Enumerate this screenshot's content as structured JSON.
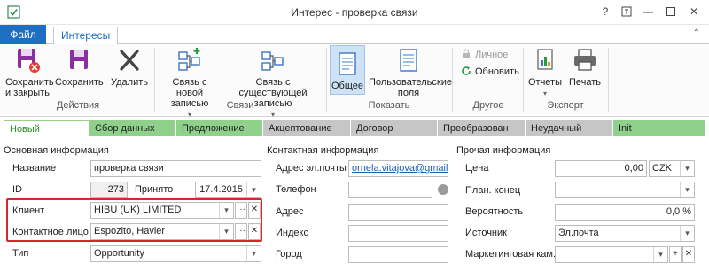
{
  "window": {
    "title": "Интерес - проверка связи",
    "help_icon": "?",
    "restore_icon": "⊡",
    "minimize_icon": "—",
    "close_icon": "✕"
  },
  "tabs": {
    "file": "Файл",
    "main": "Интересы",
    "collapse": "⌃"
  },
  "ribbon": {
    "save_close": "Сохранить и закрыть",
    "save": "Сохранить",
    "delete": "Удалить",
    "group_actions": "Действия",
    "link_new": "Связь с новой записью",
    "link_existing": "Связь с существующей записью",
    "group_links": "Связи",
    "general": "Общее",
    "user_fields": "Пользовательские поля",
    "group_show": "Показать",
    "personal": "Личное",
    "refresh": "Обновить",
    "group_other": "Другое",
    "reports": "Отчеты",
    "print": "Печать",
    "group_export": "Экспорт",
    "dropdown_marker": "▾"
  },
  "stages": [
    {
      "label": "Новый",
      "color": "#ffffff",
      "border": "#9ccc8c",
      "text": "#2b8a2b"
    },
    {
      "label": "Сбор данных",
      "color": "#8fd18b"
    },
    {
      "label": "Предложение",
      "color": "#8fd18b"
    },
    {
      "label": "Акцептование",
      "color": "#c6c6c6"
    },
    {
      "label": "Договор",
      "color": "#c6c6c6"
    },
    {
      "label": "Преобразован",
      "color": "#c6c6c6"
    },
    {
      "label": "Неудачный",
      "color": "#c6c6c6"
    },
    {
      "label": "Init",
      "color": "#8fd18b"
    }
  ],
  "basic": {
    "title": "Основная информация",
    "name_label": "Название",
    "name_value": "проверка связи",
    "id_label": "ID",
    "id_value": "273",
    "accepted_label": "Принято",
    "accepted_value": "17.4.2015",
    "client_label": "Клиент",
    "client_value": "HIBU (UK) LIMITED",
    "contact_label": "Контактное лицо",
    "contact_value": "Espozito, Havier",
    "type_label": "Тип",
    "type_value": "Opportunity",
    "more": "···",
    "clear": "✕",
    "arrow": "▾"
  },
  "contact": {
    "title": "Контактная информация",
    "email_label": "Адрес эл.почты",
    "email_value": "ornela.vitajova@gmail.com",
    "phone_label": "Телефон",
    "address_label": "Адрес",
    "zip_label": "Индекс",
    "city_label": "Город"
  },
  "other": {
    "title": "Прочая информация",
    "price_label": "Цена",
    "price_value": "0,00",
    "currency_value": "CZK",
    "plan_end_label": "План. конец",
    "probability_label": "Вероятность",
    "probability_value": "0,0 %",
    "source_label": "Источник",
    "source_value": "Эл.почта",
    "campaign_label": "Маркетинговая кам...",
    "plus": "+"
  }
}
